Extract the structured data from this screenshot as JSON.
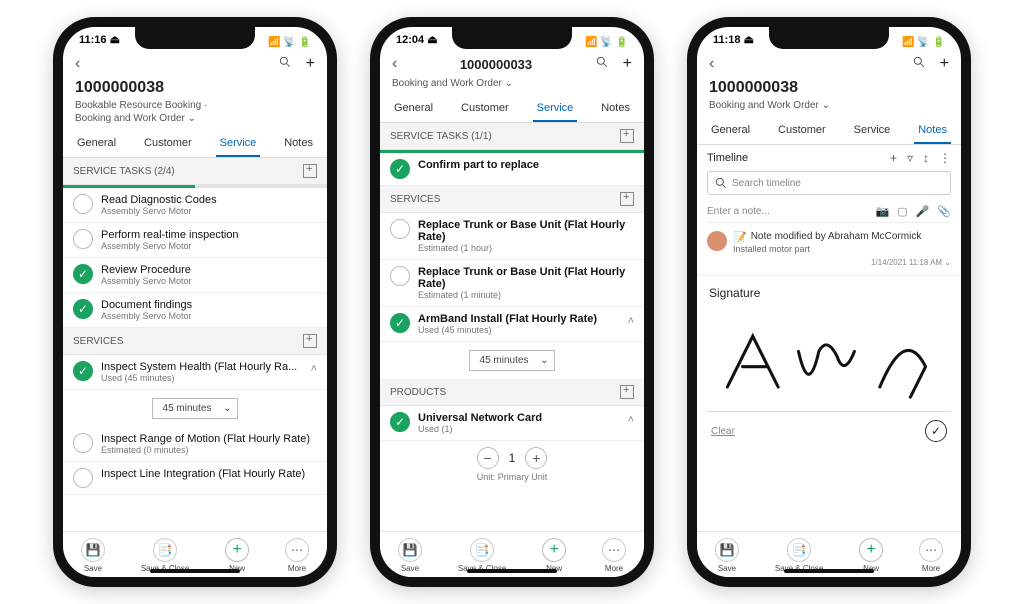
{
  "phones": [
    {
      "time": "11:16 ⏏",
      "header": {
        "title": "1000000038",
        "sub1": "Bookable Resource Booking  ·",
        "sub2": "Booking and Work Order ⌄"
      },
      "tabs": [
        "General",
        "Customer",
        "Service",
        "Notes"
      ],
      "active_tab": 2,
      "sections": {
        "service_tasks": {
          "label": "SERVICE TASKS (2/4)",
          "progress": 50,
          "items": [
            {
              "done": false,
              "title": "Read Diagnostic Codes",
              "sub": "Assembly Servo Motor"
            },
            {
              "done": false,
              "title": "Perform real-time inspection",
              "sub": "Assembly Servo Motor"
            },
            {
              "done": true,
              "title": "Review Procedure",
              "sub": "Assembly Servo Motor"
            },
            {
              "done": true,
              "title": "Document findings",
              "sub": "Assembly Servo Motor"
            }
          ]
        },
        "services": {
          "label": "SERVICES",
          "items": [
            {
              "done": true,
              "title": "Inspect System Health (Flat Hourly Ra...",
              "sub": "Used (45 minutes)",
              "expanded": true,
              "duration": "45 minutes"
            },
            {
              "done": false,
              "title": "Inspect Range of Motion (Flat Hourly Rate)",
              "sub": "Estimated (0 minutes)"
            },
            {
              "done": false,
              "title": "Inspect Line Integration (Flat Hourly Rate)",
              "sub": ""
            }
          ]
        }
      }
    },
    {
      "time": "12:04 ⏏",
      "header": {
        "title": "1000000033",
        "sub2": "Booking and Work Order ⌄"
      },
      "tabs": [
        "General",
        "Customer",
        "Service",
        "Notes"
      ],
      "active_tab": 2,
      "sections": {
        "service_tasks": {
          "label": "SERVICE TASKS (1/1)",
          "progress": 100,
          "items": [
            {
              "done": true,
              "title": "Confirm part to replace",
              "sub": ""
            }
          ]
        },
        "services": {
          "label": "SERVICES",
          "items": [
            {
              "done": false,
              "title": "Replace Trunk or Base Unit (Flat Hourly Rate)",
              "sub": "Estimated (1 hour)"
            },
            {
              "done": false,
              "title": "Replace Trunk or Base Unit (Flat Hourly Rate)",
              "sub": "Estimated (1 minute)"
            },
            {
              "done": true,
              "title": "ArmBand Install (Flat Hourly Rate)",
              "sub": "Used (45 minutes)",
              "expanded": true,
              "duration": "45 minutes"
            }
          ]
        },
        "products": {
          "label": "PRODUCTS",
          "items": [
            {
              "done": true,
              "title": "Universal Network Card",
              "sub": "Used (1)",
              "expanded": true,
              "qty": "1",
              "unit": "Unit: Primary Unit"
            }
          ]
        }
      }
    },
    {
      "time": "11:18 ⏏",
      "header": {
        "title": "1000000038",
        "sub2": "Booking and Work Order ⌄"
      },
      "tabs": [
        "General",
        "Customer",
        "Service",
        "Notes"
      ],
      "active_tab": 3,
      "timeline": {
        "label": "Timeline",
        "search_placeholder": "Search timeline",
        "entry_placeholder": "Enter a note...",
        "note": {
          "title": "Note modified by Abraham McCormick",
          "sub": "Installed motor part",
          "date": "1/14/2021 11:18 AM  ⌄"
        }
      },
      "signature": {
        "label": "Signature",
        "clear": "Clear"
      }
    }
  ],
  "bottom": {
    "save": "Save",
    "save_close": "Save & Close",
    "new": "New",
    "more": "More"
  }
}
